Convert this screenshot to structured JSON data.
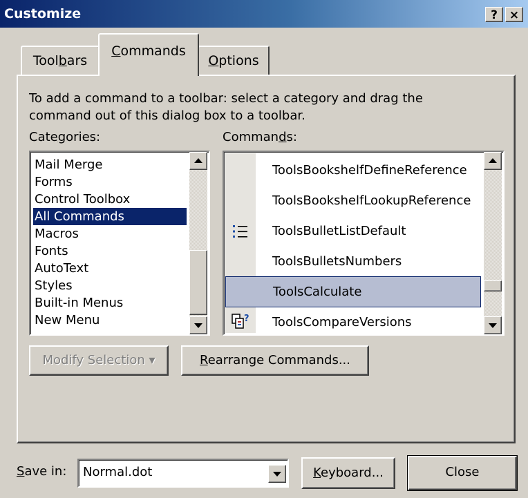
{
  "window": {
    "title": "Customize",
    "help_button": "?",
    "close_button": "×"
  },
  "tabs": [
    {
      "pre": "Tool",
      "key": "b",
      "post": "ars"
    },
    {
      "pre": "",
      "key": "C",
      "post": "ommands"
    },
    {
      "pre": "",
      "key": "O",
      "post": "ptions"
    }
  ],
  "active_tab": "Commands",
  "instructions": [
    "To add a command to a toolbar: select a category and drag the",
    "command out of this dialog box to a toolbar."
  ],
  "categories_label": {
    "pre": "Cate",
    "key": "g",
    "post": "ories:"
  },
  "commands_label": {
    "pre": "Comman",
    "key": "d",
    "post": "s:"
  },
  "categories": [
    "Mail Merge",
    "Forms",
    "Control Toolbox",
    "All Commands",
    "Macros",
    "Fonts",
    "AutoText",
    "Styles",
    "Built-in Menus",
    "New Menu"
  ],
  "selected_category": "All Commands",
  "commands": [
    {
      "label": "ToolsBookshelfDefineReference",
      "icon": ""
    },
    {
      "label": "ToolsBookshelfLookupReference",
      "icon": ""
    },
    {
      "label": "ToolsBulletListDefault",
      "icon": "bullet-list-icon"
    },
    {
      "label": "ToolsBulletsNumbers",
      "icon": ""
    },
    {
      "label": "ToolsCalculate",
      "icon": ""
    },
    {
      "label": "ToolsCompareVersions",
      "icon": "compare-versions-icon"
    }
  ],
  "selected_command": "ToolsCalculate",
  "buttons": {
    "modify_selection": "Modify Selection",
    "modify_arrow": "▾",
    "rearrange": {
      "pre": "",
      "key": "R",
      "post": "earrange Commands..."
    },
    "keyboard": {
      "pre": "",
      "key": "K",
      "post": "eyboard..."
    },
    "close": "Close"
  },
  "save_in": {
    "label": {
      "pre": "",
      "key": "S",
      "post": "ave in:"
    },
    "value": "Normal.dot"
  },
  "colors": {
    "title_gradient_start": "#0a246a",
    "title_gradient_end": "#a6caf0",
    "selection": "#0a246a",
    "command_selection": "#b6bdd2",
    "face": "#d4d0c8"
  }
}
